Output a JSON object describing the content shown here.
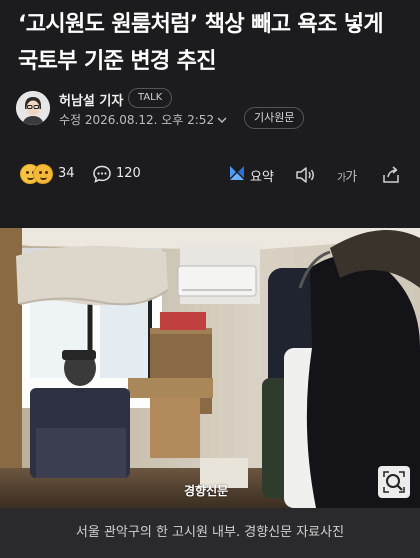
{
  "article": {
    "headline": "‘고시원도 원룸처럼’ 책상 빼고 욕조 넣게 국토부 기준 변경 추진"
  },
  "byline": {
    "reporter_name": "허남설 기자",
    "talk_label": "TALK",
    "updated_text": "수정 2026.08.12. 오후 2:52",
    "original_button": "기사원문"
  },
  "actions": {
    "reaction_count": "34",
    "comment_count": "120",
    "summary_label": "요약",
    "font_size_label_small": "가",
    "font_size_label_large": "가",
    "icons": [
      "reaction-emoji-icon",
      "comment-icon",
      "summary-icon",
      "speaker-icon",
      "font-size-icon",
      "share-icon"
    ]
  },
  "photo": {
    "watermark": "경향신문",
    "caption": "서울 관악구의 한 고시원 내부. 경향신문 자료사진"
  },
  "colors": {
    "background": "#1c1c1e",
    "caption_background": "#2a2a2c",
    "text": "#f2f2f2",
    "summary_accent": "#3b82f6"
  }
}
